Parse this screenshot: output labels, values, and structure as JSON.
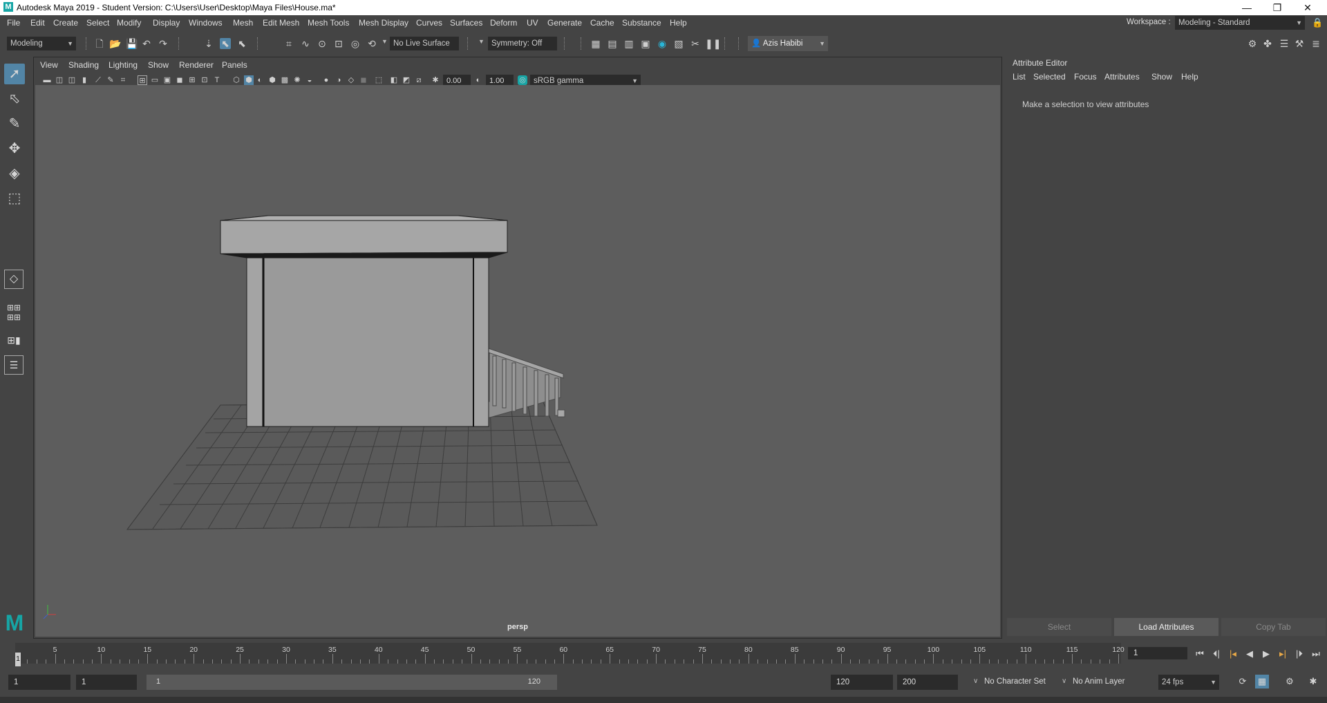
{
  "window": {
    "title": "Autodesk Maya 2019 - Student Version: C:\\Users\\User\\Desktop\\Maya Files\\House.ma*",
    "logo_letter": "M",
    "minimize": "—",
    "restore": "❐",
    "close": "✕"
  },
  "menubar": {
    "items": [
      "File",
      "Edit",
      "Create",
      "Select",
      "Modify",
      "Display",
      "Windows",
      "Mesh",
      "Edit Mesh",
      "Mesh Tools",
      "Mesh Display",
      "Curves",
      "Surfaces",
      "Deform",
      "UV",
      "Generate",
      "Cache",
      "Substance",
      "Help"
    ],
    "workspace_label": "Workspace :",
    "workspace_value": "Modeling - Standard"
  },
  "statusline": {
    "menuset": "Modeling",
    "live_surface": "No Live Surface",
    "symmetry": "Symmetry: Off",
    "user": "Azis Habibi"
  },
  "panel": {
    "menus": [
      "View",
      "Shading",
      "Lighting",
      "Show",
      "Renderer",
      "Panels"
    ],
    "exposure": "0.00",
    "gamma": "1.00",
    "color_space": "sRGB gamma",
    "camera_label": "persp"
  },
  "attribute_editor": {
    "title": "Attribute Editor",
    "menus": [
      "List",
      "Selected",
      "Focus",
      "Attributes",
      "Show",
      "Help"
    ],
    "message": "Make a selection to view attributes",
    "buttons": [
      "Select",
      "Load Attributes",
      "Copy Tab"
    ]
  },
  "timeslider": {
    "ticks": [
      "5",
      "10",
      "15",
      "20",
      "25",
      "30",
      "35",
      "40",
      "45",
      "50",
      "55",
      "60",
      "65",
      "70",
      "75",
      "80",
      "85",
      "90",
      "95",
      "100",
      "105",
      "110",
      "115",
      "120"
    ],
    "start_marker": "1",
    "current_frame": "1"
  },
  "rangeslider": {
    "start": "1",
    "playback_start": "1",
    "range_start_label": "1",
    "range_end_label": "120",
    "playback_end": "120",
    "end": "200",
    "character_set": "No Character Set",
    "anim_layer": "No Anim Layer",
    "fps": "24 fps"
  },
  "colors": {
    "ui_bg": "#444444",
    "viewport_bg": "#5d5d5d",
    "field_bg": "#2b2b2b",
    "maya_teal": "#16a5a5"
  }
}
